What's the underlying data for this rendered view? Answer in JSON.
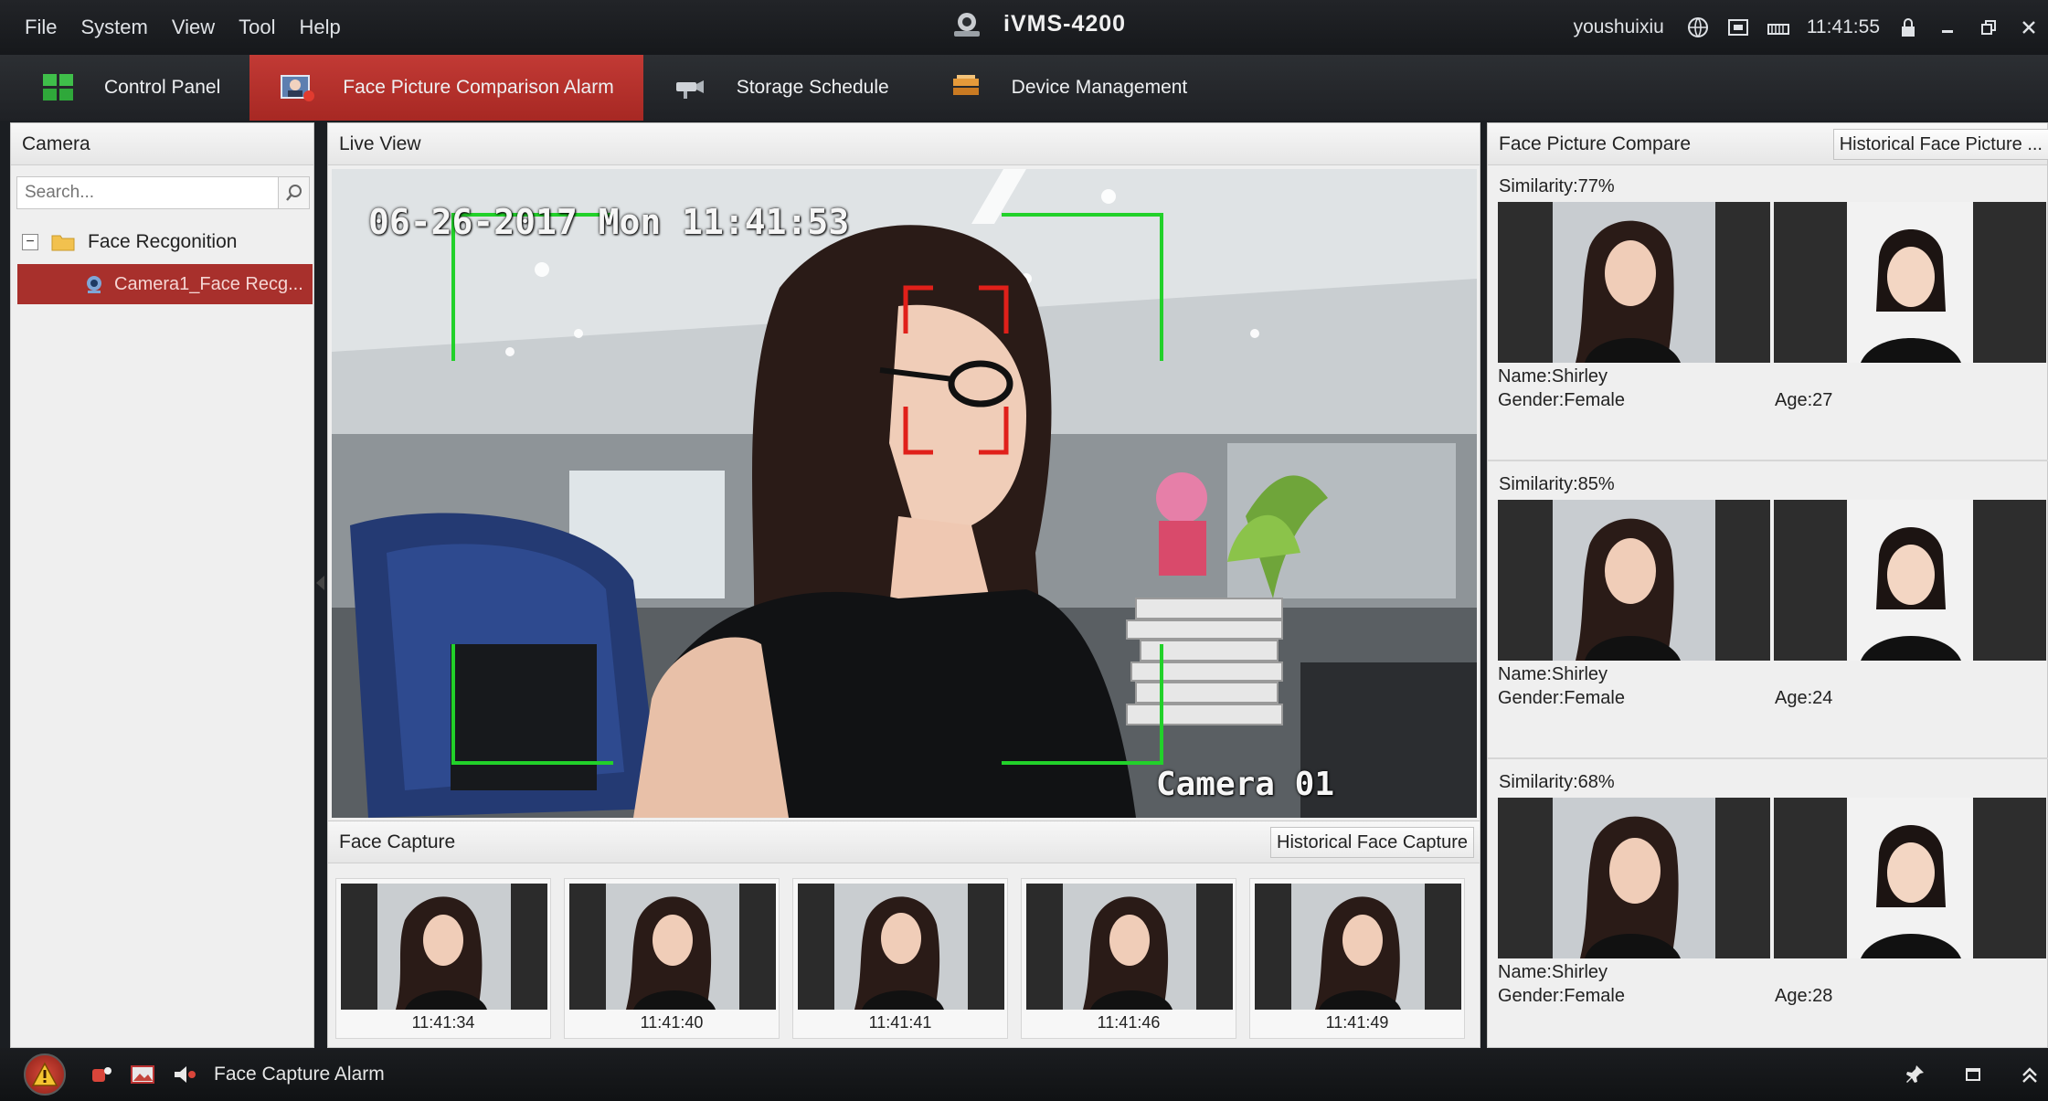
{
  "menu": {
    "items": [
      "File",
      "System",
      "View",
      "Tool",
      "Help"
    ]
  },
  "app": {
    "title": "iVMS-4200"
  },
  "status": {
    "user": "youshuixiu",
    "time": "11:41:55"
  },
  "tabs": [
    {
      "label": "Control Panel",
      "icon": "grid-icon"
    },
    {
      "label": "Face Picture Comparison Alarm",
      "icon": "face-alarm-icon",
      "active": true
    },
    {
      "label": "Storage Schedule",
      "icon": "storage-camera-icon"
    },
    {
      "label": "Device Management",
      "icon": "device-icon"
    }
  ],
  "camera_panel": {
    "title": "Camera",
    "search_placeholder": "Search...",
    "tree": {
      "group": "Face Recgonition",
      "camera": "Camera1_Face Recg..."
    }
  },
  "live_view": {
    "title": "Live View",
    "osd_time": "06-26-2017 Mon 11:41:53",
    "osd_camera": "Camera 01"
  },
  "face_capture": {
    "title": "Face Capture",
    "history_button": "Historical Face Capture",
    "captures": [
      {
        "time": "11:41:34"
      },
      {
        "time": "11:41:40"
      },
      {
        "time": "11:41:41"
      },
      {
        "time": "11:41:46"
      },
      {
        "time": "11:41:49"
      }
    ]
  },
  "face_compare": {
    "title": "Face Picture Compare",
    "history_button": "Historical Face Picture ...",
    "matches": [
      {
        "similarity": "Similarity:77%",
        "name": "Name:Shirley",
        "gender": "Gender:Female",
        "age": "Age:27"
      },
      {
        "similarity": "Similarity:85%",
        "name": "Name:Shirley",
        "gender": "Gender:Female",
        "age": "Age:24"
      },
      {
        "similarity": "Similarity:68%",
        "name": "Name:Shirley",
        "gender": "Gender:Female",
        "age": "Age:28"
      }
    ]
  },
  "bottom_bar": {
    "label": "Face Capture Alarm"
  },
  "colors": {
    "accent": "#a8302c",
    "detect_green": "#22d12a",
    "face_red": "#e0201a"
  }
}
